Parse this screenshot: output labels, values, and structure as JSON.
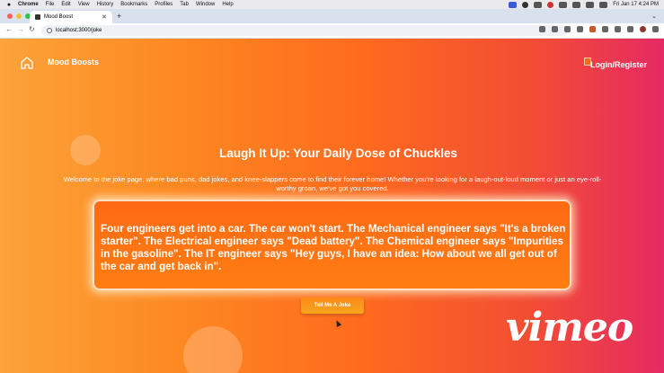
{
  "menubar": {
    "app": "Chrome",
    "items": [
      "File",
      "Edit",
      "View",
      "History",
      "Bookmarks",
      "Profiles",
      "Tab",
      "Window",
      "Help"
    ],
    "datetime": "Fri Jan 17  4:24 PM"
  },
  "browser": {
    "tab_title": "Mood Boost",
    "url": "localhost:3000/joke"
  },
  "nav": {
    "brand": "Mood Boosts",
    "login": "Login/Register"
  },
  "main": {
    "heading": "Laugh It Up: Your Daily Dose of Chuckles",
    "intro": "Welcome to the joke page, where bad puns, dad jokes, and knee-slappers come to find their forever home! Whether you're looking for a laugh-out-loud moment or just an eye-roll-worthy groan, we've got you covered.",
    "joke": "Four engineers get into a car. The car won't start. The Mechanical engineer says \"It's a broken starter\". The Electrical engineer says \"Dead battery\". The Chemical engineer says \"Impurities in the gasoline\". The IT engineer says \"Hey guys, I have an idea: How about we all get out of the car and get back in\".",
    "button": "Tell Me A Joke"
  },
  "watermark": "vimeo",
  "colors": {
    "gradient_start": "#fca33a",
    "gradient_end": "#e52a63",
    "card": "#ff6a14"
  }
}
